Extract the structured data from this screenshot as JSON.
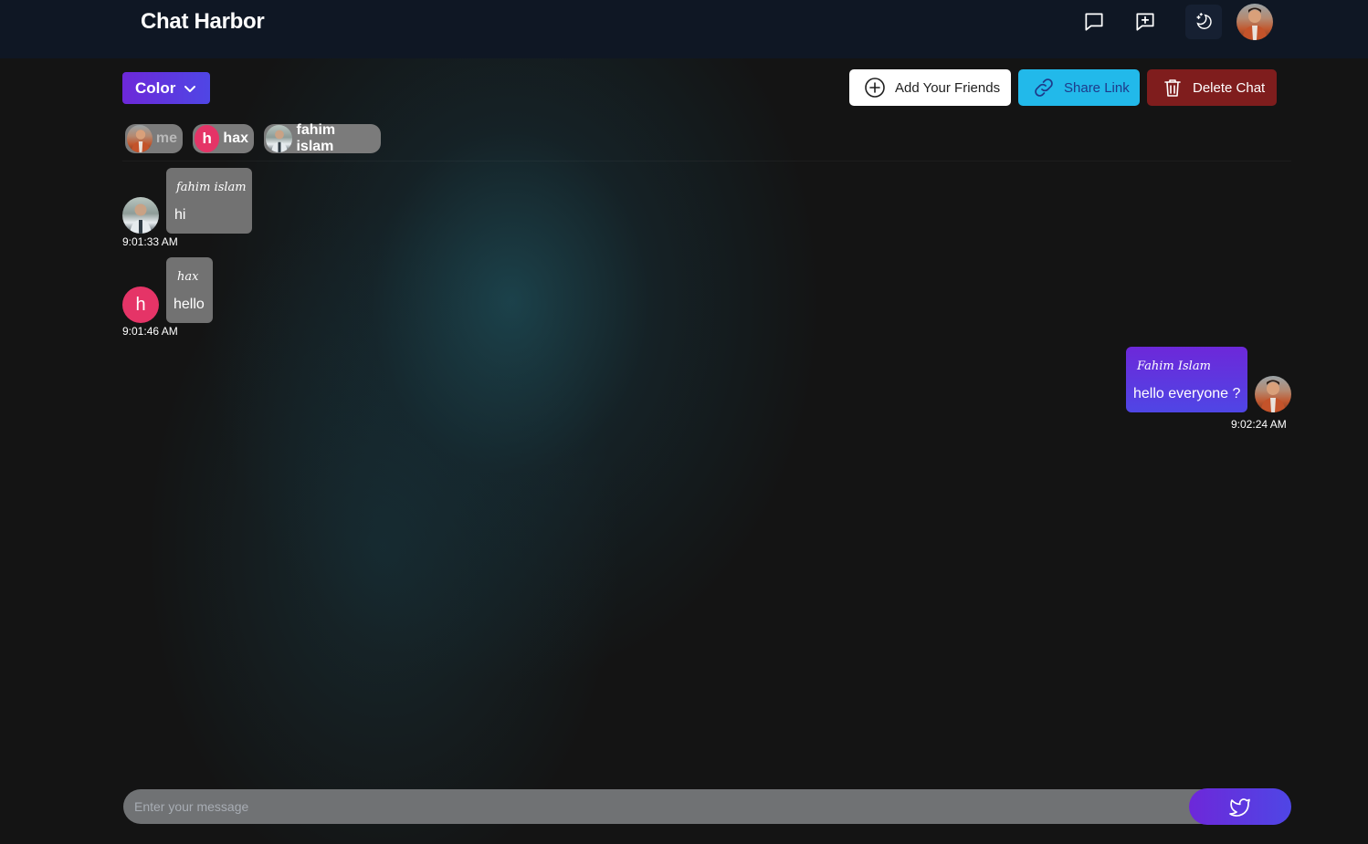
{
  "app": {
    "brand": "Chat Harbor"
  },
  "nav": {
    "icons": [
      "chat-bubble-icon",
      "new-message-icon",
      "theme-toggle-icon",
      "profile-avatar"
    ]
  },
  "toolbar": {
    "color_label": "Color",
    "add_friends_label": "Add Your Friends",
    "share_link_label": "Share Link",
    "delete_chat_label": "Delete Chat"
  },
  "members": [
    {
      "name": "me"
    },
    {
      "name": "hax",
      "initial": "h"
    },
    {
      "name": "fahim islam"
    }
  ],
  "messages": [
    {
      "sender": "fahim islam",
      "text": "hi",
      "time": "9:01:33 AM",
      "direction": "incoming"
    },
    {
      "sender": "hax",
      "text": "hello",
      "time": "9:01:46 AM",
      "direction": "incoming",
      "initial": "h"
    },
    {
      "sender": "Fahim Islam",
      "text": "hello everyone ?",
      "time": "9:02:24 AM",
      "direction": "outgoing"
    }
  ],
  "composer": {
    "placeholder": "Enter your message",
    "send_icon": "twitter-bird-icon"
  },
  "colors": {
    "navbar": "#0f1724",
    "background": "#141414",
    "accent_purple": "#6d28d9",
    "share_blue": "#22b9ea",
    "delete_red": "#7f1d1d",
    "incoming_bubble": "#727272",
    "hax_pink": "#e53467"
  }
}
